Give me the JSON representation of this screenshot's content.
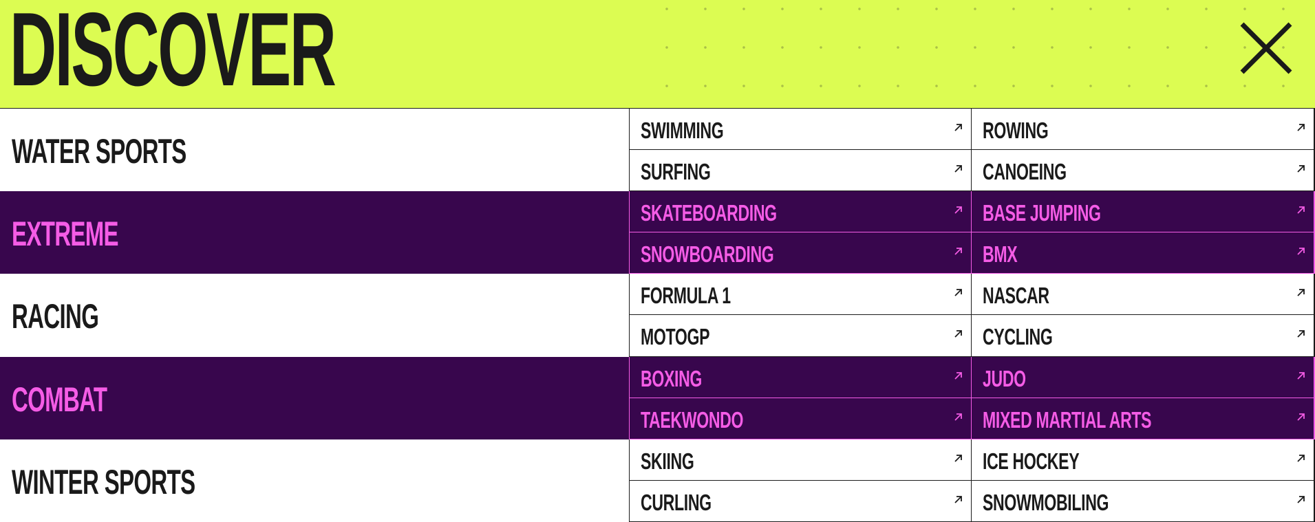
{
  "header": {
    "title": "DISCOVER",
    "close_icon": "close-icon",
    "background": "#dcfc52"
  },
  "colors": {
    "text_dark": "#1a1a1a",
    "dark_row_bg": "#38064d",
    "dark_row_text": "#f55ce6"
  },
  "categories": [
    {
      "name": "WATER SPORTS",
      "theme": "light",
      "items": [
        "SWIMMING",
        "ROWING",
        "SURFING",
        "CANOEING"
      ]
    },
    {
      "name": "EXTREME",
      "theme": "dark",
      "items": [
        "SKATEBOARDING",
        "BASE JUMPING",
        "SNOWBOARDING",
        "BMX"
      ]
    },
    {
      "name": "RACING",
      "theme": "light",
      "items": [
        "FORMULA 1",
        "NASCAR",
        "MOTOGP",
        "CYCLING"
      ]
    },
    {
      "name": "COMBAT",
      "theme": "dark",
      "items": [
        "BOXING",
        "JUDO",
        "TAEKWONDO",
        "MIXED MARTIAL ARTS"
      ]
    },
    {
      "name": "WINTER SPORTS",
      "theme": "light",
      "items": [
        "SKIING",
        "ICE HOCKEY",
        "CURLING",
        "SNOWMOBILING"
      ]
    }
  ],
  "item_icon": "arrow-up-right-icon"
}
